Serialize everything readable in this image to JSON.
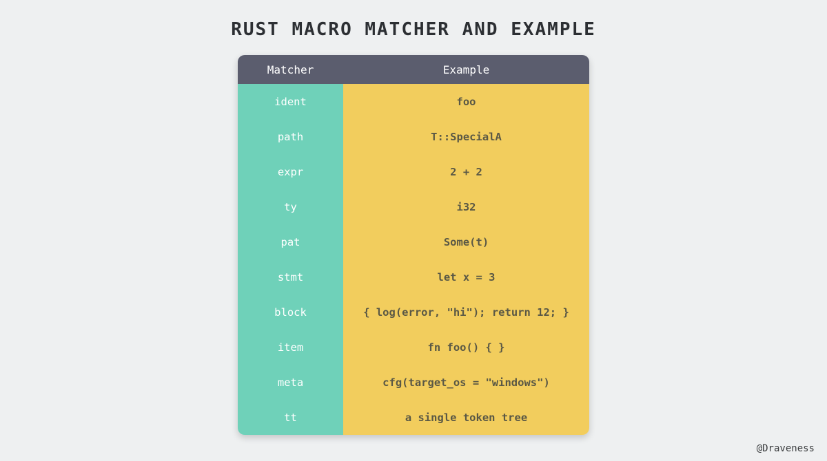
{
  "title": "RUST MACRO MATCHER AND EXAMPLE",
  "header": {
    "matcher": "Matcher",
    "example": "Example"
  },
  "rows": [
    {
      "matcher": "ident",
      "example": "foo"
    },
    {
      "matcher": "path",
      "example": "T::SpecialA"
    },
    {
      "matcher": "expr",
      "example": "2 + 2"
    },
    {
      "matcher": "ty",
      "example": "i32"
    },
    {
      "matcher": "pat",
      "example": "Some(t)"
    },
    {
      "matcher": "stmt",
      "example": "let x = 3"
    },
    {
      "matcher": "block",
      "example": "{ log(error, \"hi\"); return 12; }"
    },
    {
      "matcher": "item",
      "example": "fn foo() { }"
    },
    {
      "matcher": "meta",
      "example": "cfg(target_os = \"windows\")"
    },
    {
      "matcher": "tt",
      "example": "a single token tree"
    }
  ],
  "attribution": "@Draveness"
}
